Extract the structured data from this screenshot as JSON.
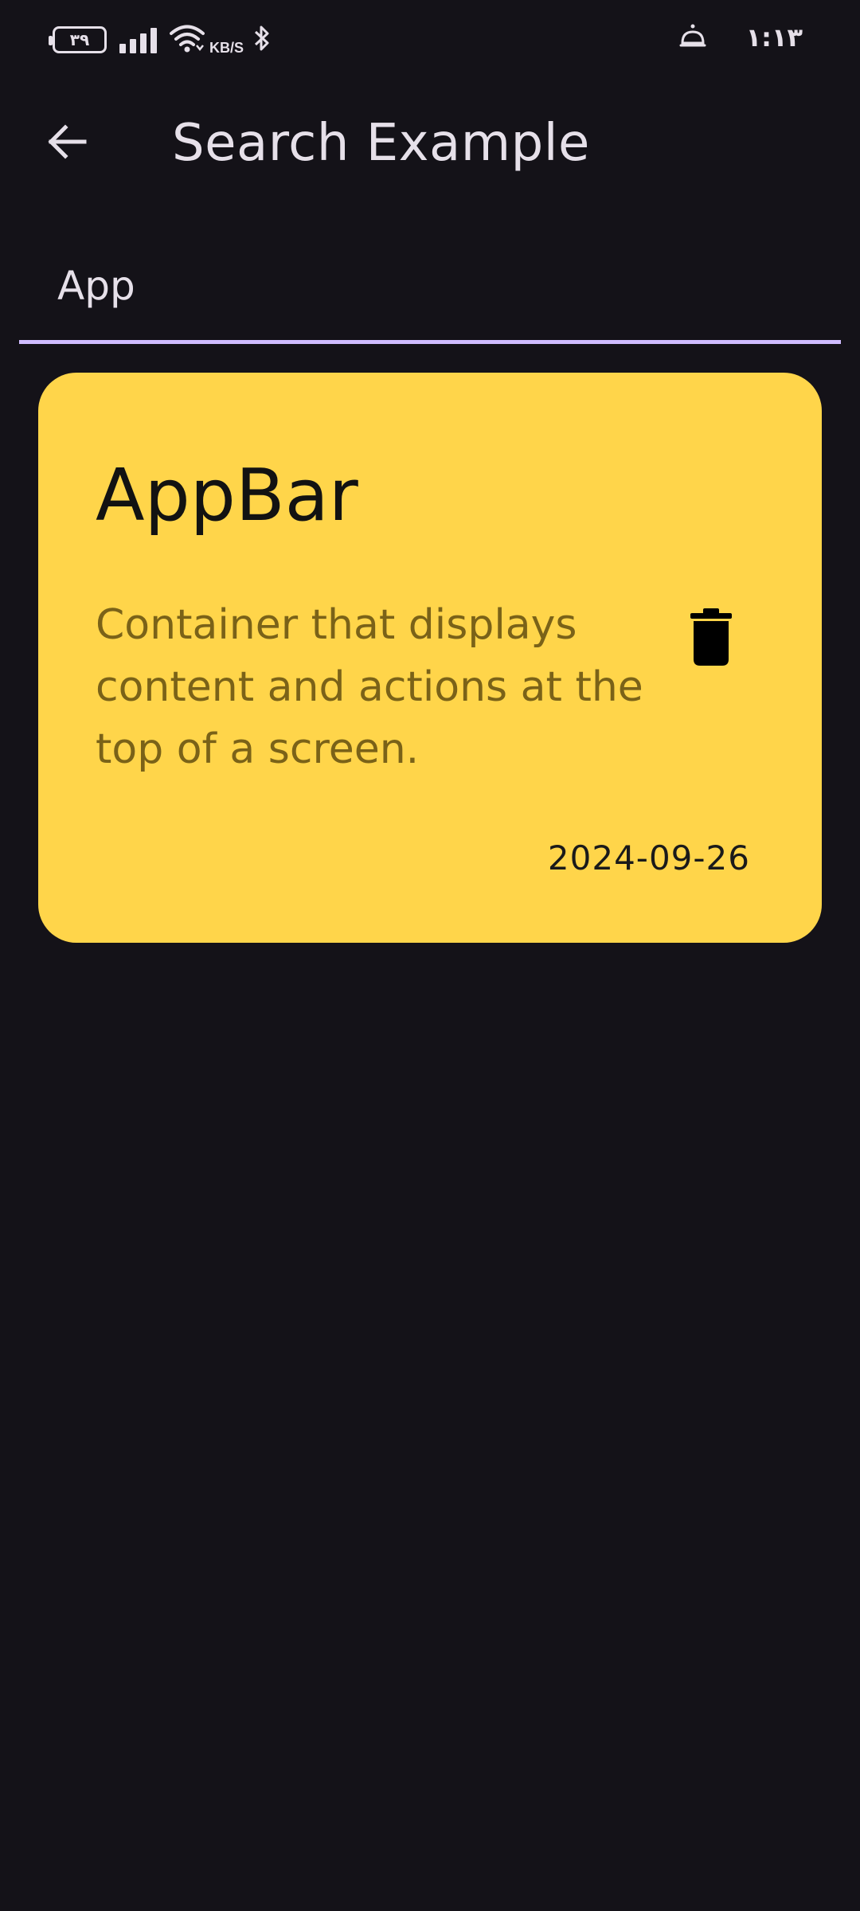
{
  "status_bar": {
    "battery_level": "۳۹",
    "net_speed_unit": "KB/S",
    "time": "۱:۱۳",
    "icons": [
      "battery-icon",
      "signal-icon",
      "wifi-icon",
      "bluetooth-icon",
      "alarm-icon"
    ]
  },
  "app_bar": {
    "title": "Search Example",
    "back_icon": "arrow-back-icon"
  },
  "search": {
    "value": "App",
    "underline_color": "#d0bcff"
  },
  "results": [
    {
      "title": "AppBar",
      "description": "Container that displays content and actions at the top of a screen.",
      "date": "2024-09-26",
      "card_color": "#ffd54a",
      "action_icon": "delete-icon"
    }
  ]
}
